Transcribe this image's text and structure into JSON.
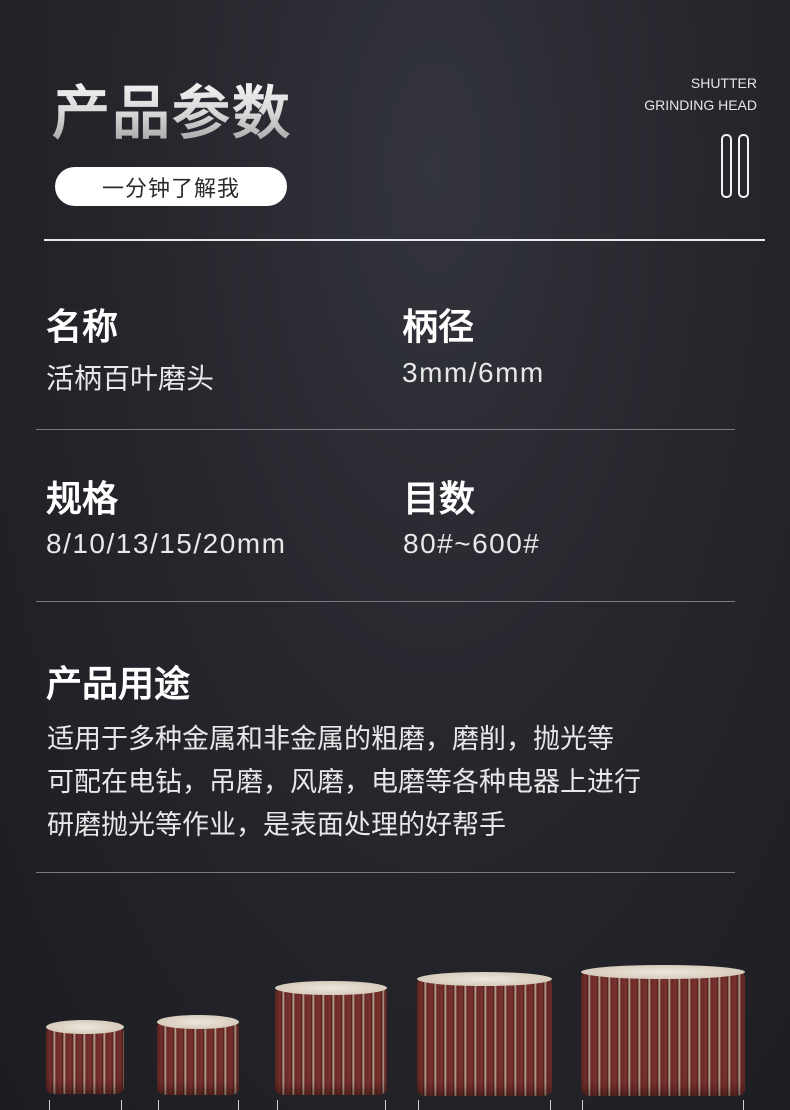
{
  "header": {
    "title": "产品参数",
    "pill_label": "一分钟了解我",
    "en_line1": "SHUTTER",
    "en_line2": "GRINDING HEAD"
  },
  "params": {
    "name_label": "名称",
    "name_value": "活柄百叶磨头",
    "shank_label": "柄径",
    "shank_value": "3mm/6mm",
    "spec_label": "规格",
    "spec_value": "8/10/13/15/20mm",
    "grit_label": "目数",
    "grit_value": "80#~600#"
  },
  "usage": {
    "label": "产品用途",
    "lines": [
      "适用于多种金属和非金属的粗磨，磨削，抛光等",
      "可配在电钻，吊磨，风磨，电磨等各种电器上进行",
      "研磨抛光等作业，是表面处理的好帮手"
    ]
  },
  "colors": {
    "background": "#26272d",
    "wheel": "#6a2a26",
    "accent": "#ffffff"
  }
}
